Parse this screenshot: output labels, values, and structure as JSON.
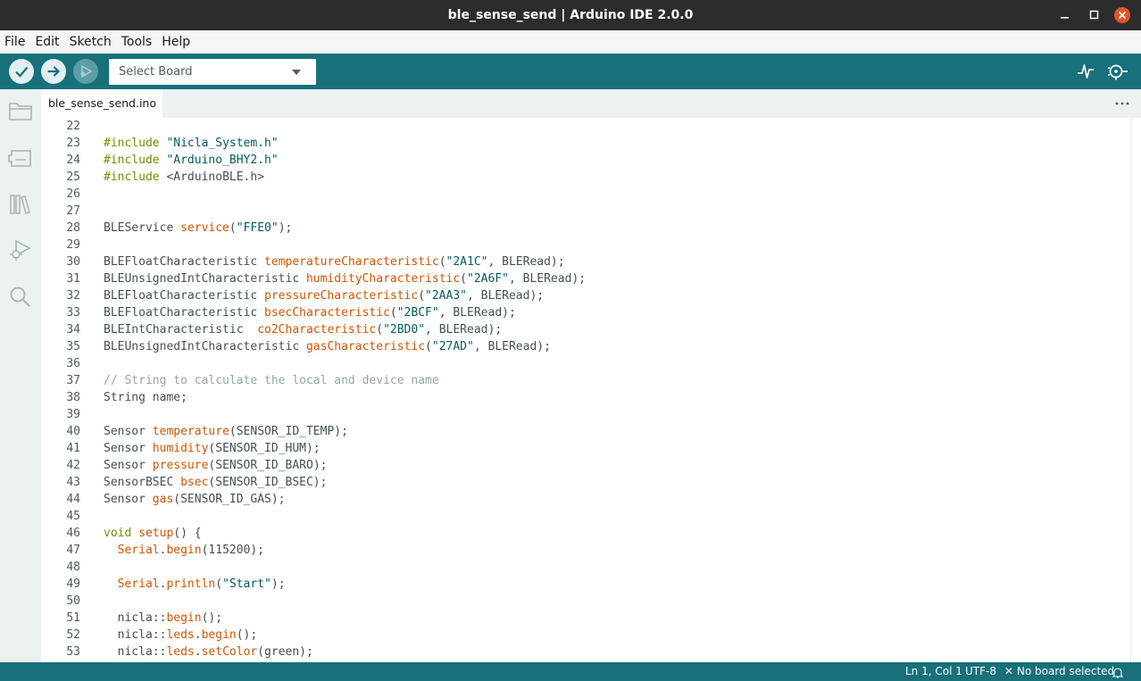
{
  "window": {
    "title": "ble_sense_send | Arduino IDE 2.0.0"
  },
  "menu": [
    "File",
    "Edit",
    "Sketch",
    "Tools",
    "Help"
  ],
  "toolbar": {
    "board_select": "Select Board",
    "icons": [
      "verify-icon",
      "upload-icon",
      "debugger-icon",
      "serial-plotter-icon",
      "serial-monitor-icon"
    ]
  },
  "sidebar": {
    "icons": [
      "sketchbook-icon",
      "boards-manager-icon",
      "library-manager-icon",
      "debug-icon",
      "search-icon"
    ]
  },
  "tabs": [
    {
      "label": "ble_sense_send.ino",
      "active": true
    }
  ],
  "editor": {
    "lines": [
      {
        "n": "22",
        "tokens": []
      },
      {
        "n": "23",
        "tokens": [
          [
            "pp",
            "#include"
          ],
          [
            "pl",
            " "
          ],
          [
            "str",
            "\"Nicla_System.h\""
          ]
        ]
      },
      {
        "n": "24",
        "tokens": [
          [
            "pp",
            "#include"
          ],
          [
            "pl",
            " "
          ],
          [
            "str",
            "\"Arduino_BHY2.h\""
          ]
        ]
      },
      {
        "n": "25",
        "tokens": [
          [
            "pp",
            "#include"
          ],
          [
            "pl",
            " <ArduinoBLE.h>"
          ]
        ]
      },
      {
        "n": "26",
        "tokens": []
      },
      {
        "n": "27",
        "tokens": []
      },
      {
        "n": "28",
        "tokens": [
          [
            "pl",
            "BLEService "
          ],
          [
            "fn",
            "service"
          ],
          [
            "pl",
            "("
          ],
          [
            "str",
            "\"FFE0\""
          ],
          [
            "pl",
            ");"
          ]
        ]
      },
      {
        "n": "29",
        "tokens": []
      },
      {
        "n": "30",
        "tokens": [
          [
            "pl",
            "BLEFloatCharacteristic "
          ],
          [
            "fn",
            "temperatureCharacteristic"
          ],
          [
            "pl",
            "("
          ],
          [
            "str",
            "\"2A1C\""
          ],
          [
            "pl",
            ", BLERead);"
          ]
        ]
      },
      {
        "n": "31",
        "tokens": [
          [
            "pl",
            "BLEUnsignedIntCharacteristic "
          ],
          [
            "fn",
            "humidityCharacteristic"
          ],
          [
            "pl",
            "("
          ],
          [
            "str",
            "\"2A6F\""
          ],
          [
            "pl",
            ", BLERead);"
          ]
        ]
      },
      {
        "n": "32",
        "tokens": [
          [
            "pl",
            "BLEFloatCharacteristic "
          ],
          [
            "fn",
            "pressureCharacteristic"
          ],
          [
            "pl",
            "("
          ],
          [
            "str",
            "\"2AA3\""
          ],
          [
            "pl",
            ", BLERead);"
          ]
        ]
      },
      {
        "n": "33",
        "tokens": [
          [
            "pl",
            "BLEFloatCharacteristic "
          ],
          [
            "fn",
            "bsecCharacteristic"
          ],
          [
            "pl",
            "("
          ],
          [
            "str",
            "\"2BCF\""
          ],
          [
            "pl",
            ", BLERead);"
          ]
        ]
      },
      {
        "n": "34",
        "tokens": [
          [
            "pl",
            "BLEIntCharacteristic  "
          ],
          [
            "fn",
            "co2Characteristic"
          ],
          [
            "pl",
            "("
          ],
          [
            "str",
            "\"2BD0\""
          ],
          [
            "pl",
            ", BLERead);"
          ]
        ]
      },
      {
        "n": "35",
        "tokens": [
          [
            "pl",
            "BLEUnsignedIntCharacteristic "
          ],
          [
            "fn",
            "gasCharacteristic"
          ],
          [
            "pl",
            "("
          ],
          [
            "str",
            "\"27AD\""
          ],
          [
            "pl",
            ", BLERead);"
          ]
        ]
      },
      {
        "n": "36",
        "tokens": []
      },
      {
        "n": "37",
        "tokens": [
          [
            "cm",
            "// String to calculate the local and device name"
          ]
        ]
      },
      {
        "n": "38",
        "tokens": [
          [
            "pl",
            "String name;"
          ]
        ]
      },
      {
        "n": "39",
        "tokens": []
      },
      {
        "n": "40",
        "tokens": [
          [
            "pl",
            "Sensor "
          ],
          [
            "fn",
            "temperature"
          ],
          [
            "pl",
            "(SENSOR_ID_TEMP);"
          ]
        ]
      },
      {
        "n": "41",
        "tokens": [
          [
            "pl",
            "Sensor "
          ],
          [
            "fn",
            "humidity"
          ],
          [
            "pl",
            "(SENSOR_ID_HUM);"
          ]
        ]
      },
      {
        "n": "42",
        "tokens": [
          [
            "pl",
            "Sensor "
          ],
          [
            "fn",
            "pressure"
          ],
          [
            "pl",
            "(SENSOR_ID_BARO);"
          ]
        ]
      },
      {
        "n": "43",
        "tokens": [
          [
            "pl",
            "SensorBSEC "
          ],
          [
            "fn",
            "bsec"
          ],
          [
            "pl",
            "(SENSOR_ID_BSEC);"
          ]
        ]
      },
      {
        "n": "44",
        "tokens": [
          [
            "pl",
            "Sensor "
          ],
          [
            "fn",
            "gas"
          ],
          [
            "pl",
            "(SENSOR_ID_GAS);"
          ]
        ]
      },
      {
        "n": "45",
        "tokens": []
      },
      {
        "n": "46",
        "tokens": [
          [
            "kw",
            "void"
          ],
          [
            "pl",
            " "
          ],
          [
            "fn",
            "setup"
          ],
          [
            "pl",
            "() {"
          ]
        ]
      },
      {
        "n": "47",
        "tokens": [
          [
            "pl",
            "  "
          ],
          [
            "fn",
            "Serial"
          ],
          [
            "pl",
            "."
          ],
          [
            "fn",
            "begin"
          ],
          [
            "pl",
            "(115200);"
          ]
        ]
      },
      {
        "n": "48",
        "tokens": []
      },
      {
        "n": "49",
        "tokens": [
          [
            "pl",
            "  "
          ],
          [
            "fn",
            "Serial"
          ],
          [
            "pl",
            "."
          ],
          [
            "fn",
            "println"
          ],
          [
            "pl",
            "("
          ],
          [
            "str",
            "\"Start\""
          ],
          [
            "pl",
            ");"
          ]
        ]
      },
      {
        "n": "50",
        "tokens": []
      },
      {
        "n": "51",
        "tokens": [
          [
            "pl",
            "  nicla::"
          ],
          [
            "fn",
            "begin"
          ],
          [
            "pl",
            "();"
          ]
        ]
      },
      {
        "n": "52",
        "tokens": [
          [
            "pl",
            "  nicla::"
          ],
          [
            "fn",
            "leds"
          ],
          [
            "pl",
            "."
          ],
          [
            "fn",
            "begin"
          ],
          [
            "pl",
            "();"
          ]
        ]
      },
      {
        "n": "53",
        "tokens": [
          [
            "pl",
            "  nicla::"
          ],
          [
            "fn",
            "leds"
          ],
          [
            "pl",
            "."
          ],
          [
            "fn",
            "setColor"
          ],
          [
            "pl",
            "(green);"
          ]
        ]
      }
    ]
  },
  "status": {
    "cursor": "Ln 1, Col 1",
    "encoding": "UTF-8",
    "board": "No board selected"
  },
  "colors": {
    "toolbar_bg": "#17707a",
    "titlebar_bg": "#2c2c2c",
    "sidebar_bg": "#ecf1f1",
    "keyword": "#728e00",
    "function": "#d35400",
    "string": "#005c5f",
    "comment": "#95a5a6"
  }
}
